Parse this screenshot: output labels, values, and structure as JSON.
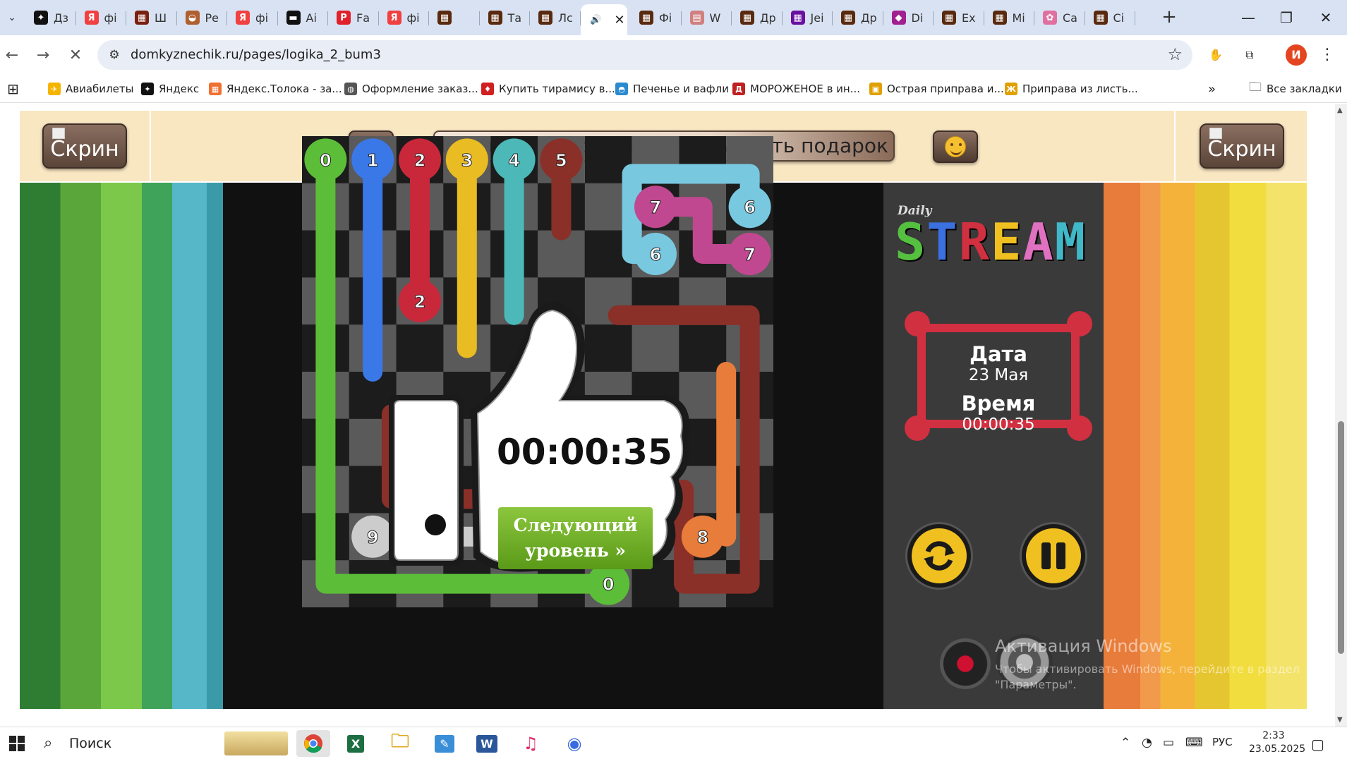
{
  "browser": {
    "tabs": [
      {
        "label": "Дз",
        "color": "#111111",
        "glyph": "✦"
      },
      {
        "label": "фі",
        "color": "#f04040",
        "glyph": "Я"
      },
      {
        "label": "Ш",
        "color": "#7a2010",
        "glyph": "▦"
      },
      {
        "label": "Ре",
        "color": "#b06030",
        "glyph": "◒"
      },
      {
        "label": "фі",
        "color": "#f04040",
        "glyph": "Я"
      },
      {
        "label": "Аі",
        "color": "#111111",
        "glyph": "▬"
      },
      {
        "label": "Fа",
        "color": "#e0202a",
        "glyph": "P"
      },
      {
        "label": "фі",
        "color": "#f04040",
        "glyph": "Я"
      },
      {
        "label": "",
        "color": "#5a2a10",
        "glyph": "▦"
      },
      {
        "label": "Та",
        "color": "#5a2a10",
        "glyph": "▦"
      },
      {
        "label": "Лс",
        "color": "#5a2a10",
        "glyph": "▦"
      },
      {
        "label": "",
        "color": "#ffffff",
        "glyph": "🔊",
        "active": true
      },
      {
        "label": "Фі",
        "color": "#5a2a10",
        "glyph": "▦"
      },
      {
        "label": "W",
        "color": "#d08080",
        "glyph": "▤"
      },
      {
        "label": "Др",
        "color": "#5a2a10",
        "glyph": "▦"
      },
      {
        "label": "Jeі",
        "color": "#6a10a0",
        "glyph": "▦"
      },
      {
        "label": "Др",
        "color": "#5a2a10",
        "glyph": "▦"
      },
      {
        "label": "Di",
        "color": "#a02090",
        "glyph": "◆"
      },
      {
        "label": "Ех",
        "color": "#5a2a10",
        "glyph": "▦"
      },
      {
        "label": "Мі",
        "color": "#5a2a10",
        "glyph": "▦"
      },
      {
        "label": "Са",
        "color": "#e070a0",
        "glyph": "✿"
      },
      {
        "label": "Сі",
        "color": "#5a2a10",
        "glyph": "▦"
      }
    ],
    "url": "domkyznechik.ru/pages/logika_2_bum3",
    "bookmarks": [
      {
        "label": "Авиабилеты",
        "color": "#f5b400",
        "glyph": "✈"
      },
      {
        "label": "Яндекс",
        "color": "#111111",
        "glyph": "✦"
      },
      {
        "label": "Яндекс.Толока - за...",
        "color": "#f07030",
        "glyph": "▦"
      },
      {
        "label": "Оформление заказ...",
        "color": "#555555",
        "glyph": "◍"
      },
      {
        "label": "Купить тирамису в...",
        "color": "#d02020",
        "glyph": "♦"
      },
      {
        "label": "Печенье и вафли",
        "color": "#2a8ad0",
        "glyph": "◓"
      },
      {
        "label": "МОРОЖЕНОЕ в ин...",
        "color": "#c02020",
        "glyph": "Д"
      },
      {
        "label": "Острая приправа и...",
        "color": "#e0a000",
        "glyph": "▣"
      },
      {
        "label": "Приправа из листь...",
        "color": "#e0a000",
        "glyph": "Ж"
      }
    ],
    "all_bookmarks_label": "Все закладки"
  },
  "page": {
    "screen_button_label": "Скрин",
    "share_button_label": "Выложить скрин игры и получить подарок"
  },
  "game": {
    "logo_daily": "Daily",
    "logo_stream_letters": [
      {
        "ch": "S",
        "color": "#55c040"
      },
      {
        "ch": "T",
        "color": "#3a70e0"
      },
      {
        "ch": "R",
        "color": "#d03040"
      },
      {
        "ch": "E",
        "color": "#f0c020"
      },
      {
        "ch": "A",
        "color": "#e070c0"
      },
      {
        "ch": "M",
        "color": "#40b8c8"
      }
    ],
    "date_label": "Дата",
    "date_value": "23 Мая",
    "time_label": "Время",
    "time_value": "00:00:35",
    "win_time": "00:00:35",
    "next_level_label": "Следующий уровень »",
    "grid_size": 10,
    "endpoints": [
      {
        "n": "0",
        "color": "#5cbd38",
        "c": 0,
        "r": 0
      },
      {
        "n": "0",
        "color": "#5cbd38",
        "c": 6,
        "r": 9
      },
      {
        "n": "1",
        "color": "#3a78e8",
        "c": 1,
        "r": 0
      },
      {
        "n": "2",
        "color": "#c8283a",
        "c": 2,
        "r": 0
      },
      {
        "n": "2",
        "color": "#c8283a",
        "c": 2,
        "r": 3
      },
      {
        "n": "3",
        "color": "#e8bc22",
        "c": 3,
        "r": 0
      },
      {
        "n": "4",
        "color": "#4cb8b8",
        "c": 4,
        "r": 0
      },
      {
        "n": "5",
        "color": "#8a3028",
        "c": 5,
        "r": 0
      },
      {
        "n": "6",
        "color": "#78c8e0",
        "c": 9,
        "r": 1
      },
      {
        "n": "6",
        "color": "#78c8e0",
        "c": 7,
        "r": 2
      },
      {
        "n": "7",
        "color": "#c04890",
        "c": 7,
        "r": 1
      },
      {
        "n": "7",
        "color": "#c04890",
        "c": 9,
        "r": 2
      },
      {
        "n": "8",
        "color": "#e87c3a",
        "c": 8,
        "r": 8
      },
      {
        "n": "9",
        "color": "#cccccc",
        "c": 1,
        "r": 8
      }
    ]
  },
  "windows": {
    "activation_title": "Активация Windows",
    "activation_sub": "Чтобы активировать Windows, перейдите в раздел \"Параметры\".",
    "search_placeholder": "Поиск",
    "language": "РУС",
    "clock_time": "2:33",
    "clock_date": "23.05.2025"
  }
}
